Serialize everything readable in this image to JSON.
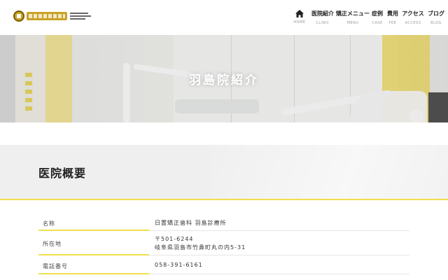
{
  "nav": {
    "items": [
      {
        "jp": "",
        "en": "HOME",
        "icon": "home-icon"
      },
      {
        "jp": "医院紹介",
        "en": "CLINIC"
      },
      {
        "jp": "矯正メニュー",
        "en": "MENU"
      },
      {
        "jp": "症例",
        "en": "CASE"
      },
      {
        "jp": "費用",
        "en": "FEE"
      },
      {
        "jp": "アクセス",
        "en": "ACCESS"
      },
      {
        "jp": "ブログ",
        "en": "BLOG"
      }
    ]
  },
  "hero": {
    "title": "羽島院紹介"
  },
  "section": {
    "title": "医院概要"
  },
  "table": {
    "rows": [
      {
        "label": "名称",
        "value": "日置矯正歯科 羽島診療所"
      },
      {
        "label": "所在地",
        "value_line1": "〒501-6244",
        "value_line2": "岐阜県羽島市竹鼻町丸の内5-31"
      },
      {
        "label": "電話番号",
        "value": "058-391-6161"
      }
    ]
  },
  "colors": {
    "accent": "#f1df4b",
    "band": "#efefef",
    "text": "#333333"
  }
}
